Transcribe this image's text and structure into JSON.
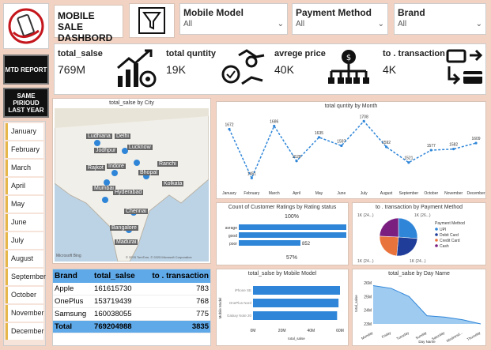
{
  "header": {
    "title": "MOBILE SALE DASHBORD"
  },
  "slicers": [
    {
      "label": "Mobile Model",
      "value": "All"
    },
    {
      "label": "Payment Method",
      "value": "All"
    },
    {
      "label": "Brand",
      "value": "All"
    }
  ],
  "kpis": [
    {
      "label": "total_salse",
      "value": "769M",
      "icon": "growth-chart-icon"
    },
    {
      "label": "total quntity",
      "value": "19K",
      "icon": "handshake-icon"
    },
    {
      "label": "avrege price",
      "value": "40K",
      "icon": "money-network-icon"
    },
    {
      "label": "to . transaction",
      "value": "4K",
      "icon": "card-transfer-icon"
    }
  ],
  "buttons": {
    "mtd": "MTD REPORT",
    "same_period": "SAME PIRIOUD LAST YEAR"
  },
  "months": [
    "January",
    "February",
    "March",
    "April",
    "May",
    "June",
    "July",
    "August",
    "September",
    "October",
    "November",
    "December"
  ],
  "map": {
    "title": "total_salse by City",
    "cities": [
      "Ludhiana",
      "Delhi",
      "Jodhpur",
      "Lucknow",
      "Rajkot",
      "Indore",
      "Ranchi",
      "Bhopal",
      "Mumbai",
      "Kolkata",
      "Hyderabad",
      "Chennai",
      "Bangalore",
      "Madurai"
    ],
    "attribution": "© 2025 TomTom, © 2025 Microsoft Corporation",
    "brand": "Microsoft Bing"
  },
  "table": {
    "headers": [
      "Brand",
      "total_salse",
      "to . transaction"
    ],
    "rows": [
      [
        "Apple",
        "161615730",
        "783"
      ],
      [
        "OnePlus",
        "153719439",
        "768"
      ],
      [
        "Samsung",
        "160038055",
        "775"
      ]
    ],
    "total": [
      "Total",
      "769204988",
      "3835"
    ]
  },
  "chart_data": [
    {
      "type": "line",
      "title": "total quntity by Month",
      "categories": [
        "January",
        "February",
        "March",
        "April",
        "May",
        "June",
        "July",
        "August",
        "September",
        "October",
        "November",
        "December"
      ],
      "values": [
        1672,
        1451,
        1686,
        1528,
        1635,
        1597,
        1708,
        1592,
        1521,
        1577,
        1582,
        1609
      ],
      "color": "#2f86d8",
      "line_style": "dashed"
    },
    {
      "type": "bar",
      "orientation": "horizontal",
      "title": "Count of Customer Ratings by Rating status",
      "categories": [
        "avrage",
        "good",
        "poor"
      ],
      "values": [
        1485,
        1485,
        852
      ],
      "value_labels": [
        "",
        "",
        "852"
      ],
      "top_label": "100%",
      "bottom_label": "57%",
      "color": "#2f86d8"
    },
    {
      "type": "pie",
      "title": "to . transaction by Payment Method",
      "legend_title": "Payment Method",
      "slices": [
        {
          "name": "UPI",
          "value": 26,
          "color": "#2f86d8"
        },
        {
          "name": "Debit Card",
          "value": 25,
          "color": "#1f3d99"
        },
        {
          "name": "Credit Card",
          "value": 24,
          "color": "#e9733d"
        },
        {
          "name": "Cash",
          "value": 24,
          "color": "#7a1e80"
        }
      ],
      "slice_labels": [
        "1K (26...)",
        "1K (24...)",
        "1K (24...)",
        "1K (24...)"
      ],
      "legend_placement": "right"
    },
    {
      "type": "bar",
      "orientation": "horizontal",
      "title": "total_salse by Mobile Model",
      "categories": [
        "iPhone SE",
        "OnePlus Nord",
        "Galaxy Note 20"
      ],
      "values": [
        60,
        59,
        58
      ],
      "xlabel": "total_salse",
      "ylabel": "Mobile Model",
      "x_ticks": [
        "0M",
        "20M",
        "40M",
        "60M"
      ],
      "xlim": [
        0,
        60
      ],
      "color": "#2f86d8"
    },
    {
      "type": "area",
      "title": "total_salse by Day Name",
      "categories": [
        "Monday",
        "Friday",
        "Tuesday",
        "Sunday",
        "Saturday",
        "Wednesd...",
        "Thursday"
      ],
      "values": [
        25.8,
        25.6,
        25.0,
        23.6,
        23.5,
        23.3,
        23.0
      ],
      "ylabel": "total_salse",
      "xlabel": "Day Name",
      "y_ticks": [
        "23M",
        "24M",
        "25M",
        "26M"
      ],
      "ylim": [
        23,
        26
      ],
      "color": "#5fa9e8"
    }
  ]
}
